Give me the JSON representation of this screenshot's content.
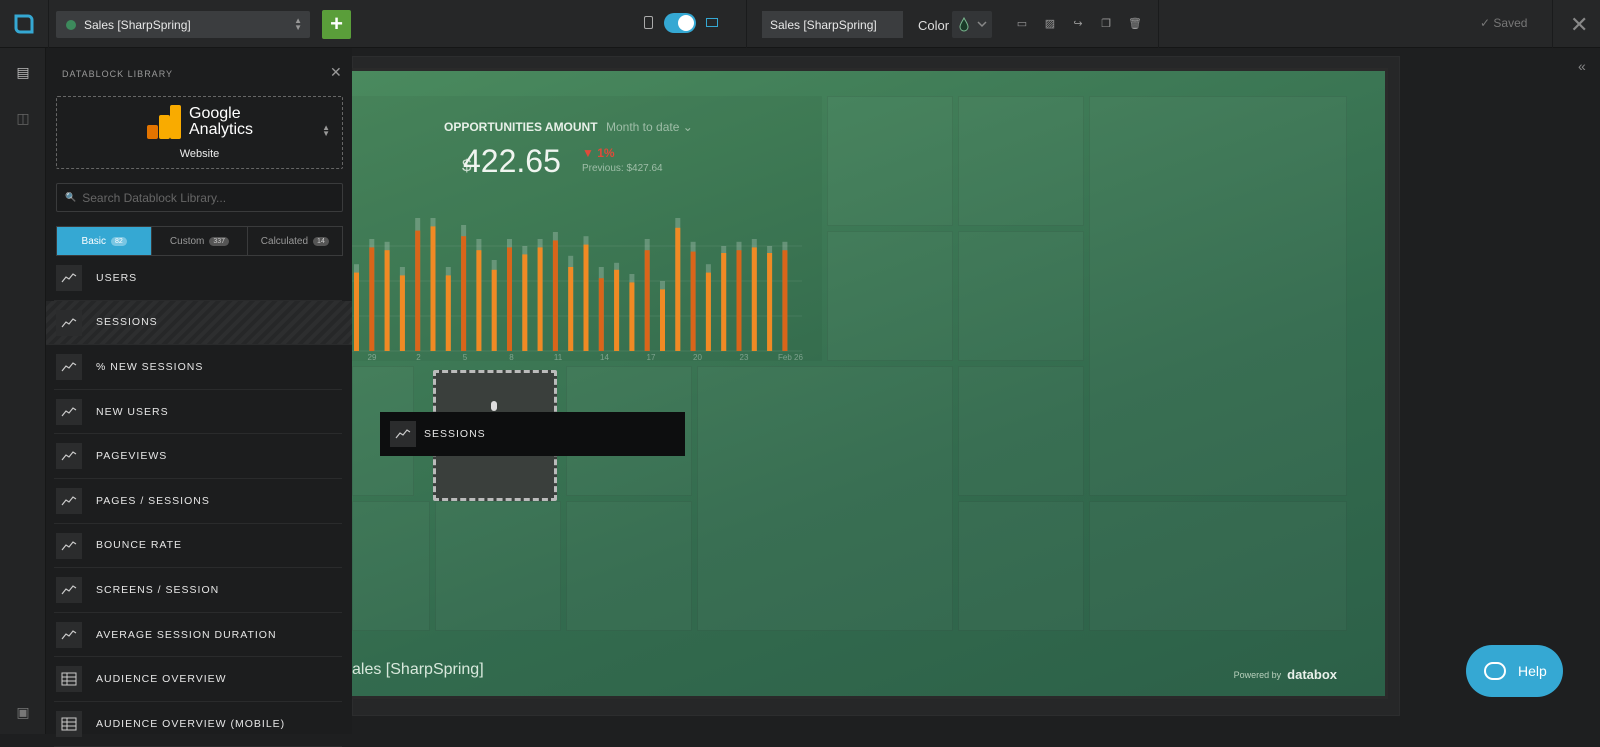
{
  "topbar": {
    "dashboard_name": "Sales [SharpSpring]",
    "add_label": "+",
    "title_value": "Sales [SharpSpring]",
    "color_label": "Color",
    "saved_label": "Saved",
    "status_accent": "#35a8d3"
  },
  "library": {
    "title": "DATABLOCK LIBRARY",
    "source_name_line1": "Google",
    "source_name_line2": "Analytics",
    "source_sub": "Website",
    "search_placeholder": "Search Datablock Library...",
    "tabs": [
      {
        "label": "Basic",
        "count": "82"
      },
      {
        "label": "Custom",
        "count": "337"
      },
      {
        "label": "Calculated",
        "count": "14"
      }
    ],
    "items": [
      {
        "label": "USERS",
        "icon": "line-chart-icon"
      },
      {
        "label": "SESSIONS",
        "icon": "line-chart-icon"
      },
      {
        "label": "% NEW SESSIONS",
        "icon": "line-chart-icon"
      },
      {
        "label": "NEW USERS",
        "icon": "line-chart-icon"
      },
      {
        "label": "PAGEVIEWS",
        "icon": "line-chart-icon"
      },
      {
        "label": "PAGES / SESSIONS",
        "icon": "line-chart-icon"
      },
      {
        "label": "BOUNCE RATE",
        "icon": "line-chart-icon"
      },
      {
        "label": "SCREENS / SESSION",
        "icon": "line-chart-icon"
      },
      {
        "label": "AVERAGE SESSION DURATION",
        "icon": "line-chart-icon"
      },
      {
        "label": "AUDIENCE OVERVIEW",
        "icon": "table-icon"
      },
      {
        "label": "AUDIENCE OVERVIEW (MOBILE)",
        "icon": "table-icon"
      }
    ]
  },
  "datablock": {
    "title": "OPPORTUNITIES AMOUNT",
    "period": "Month to date",
    "currency": "$",
    "value": "422.65",
    "change": "1%",
    "previous": "Previous: $427.64",
    "x_labels": [
      "29",
      "2",
      "5",
      "8",
      "11",
      "14",
      "17",
      "20",
      "23",
      "Feb 26"
    ]
  },
  "canvas": {
    "footer_name": "ales [SharpSpring]",
    "powered_by": "Powered by",
    "brand": "databox",
    "dragging_label": "SESSIONS"
  },
  "help_label": "Help",
  "chart_data": {
    "type": "bar",
    "series": [
      {
        "values": [
          0.62,
          0.8,
          0.78,
          0.6,
          0.95,
          0.95,
          0.6,
          0.9,
          0.8,
          0.65,
          0.8,
          0.75,
          0.8,
          0.85,
          0.68,
          0.82,
          0.6,
          0.63,
          0.55,
          0.8,
          0.5,
          0.95,
          0.78,
          0.62,
          0.75,
          0.78,
          0.8,
          0.75,
          0.78
        ]
      },
      {
        "values": [
          0.56,
          0.74,
          0.72,
          0.54,
          0.86,
          0.89,
          0.54,
          0.82,
          0.72,
          0.58,
          0.74,
          0.69,
          0.74,
          0.79,
          0.6,
          0.76,
          0.52,
          0.58,
          0.49,
          0.72,
          0.44,
          0.88,
          0.71,
          0.56,
          0.7,
          0.72,
          0.74,
          0.7,
          0.72
        ]
      }
    ]
  }
}
